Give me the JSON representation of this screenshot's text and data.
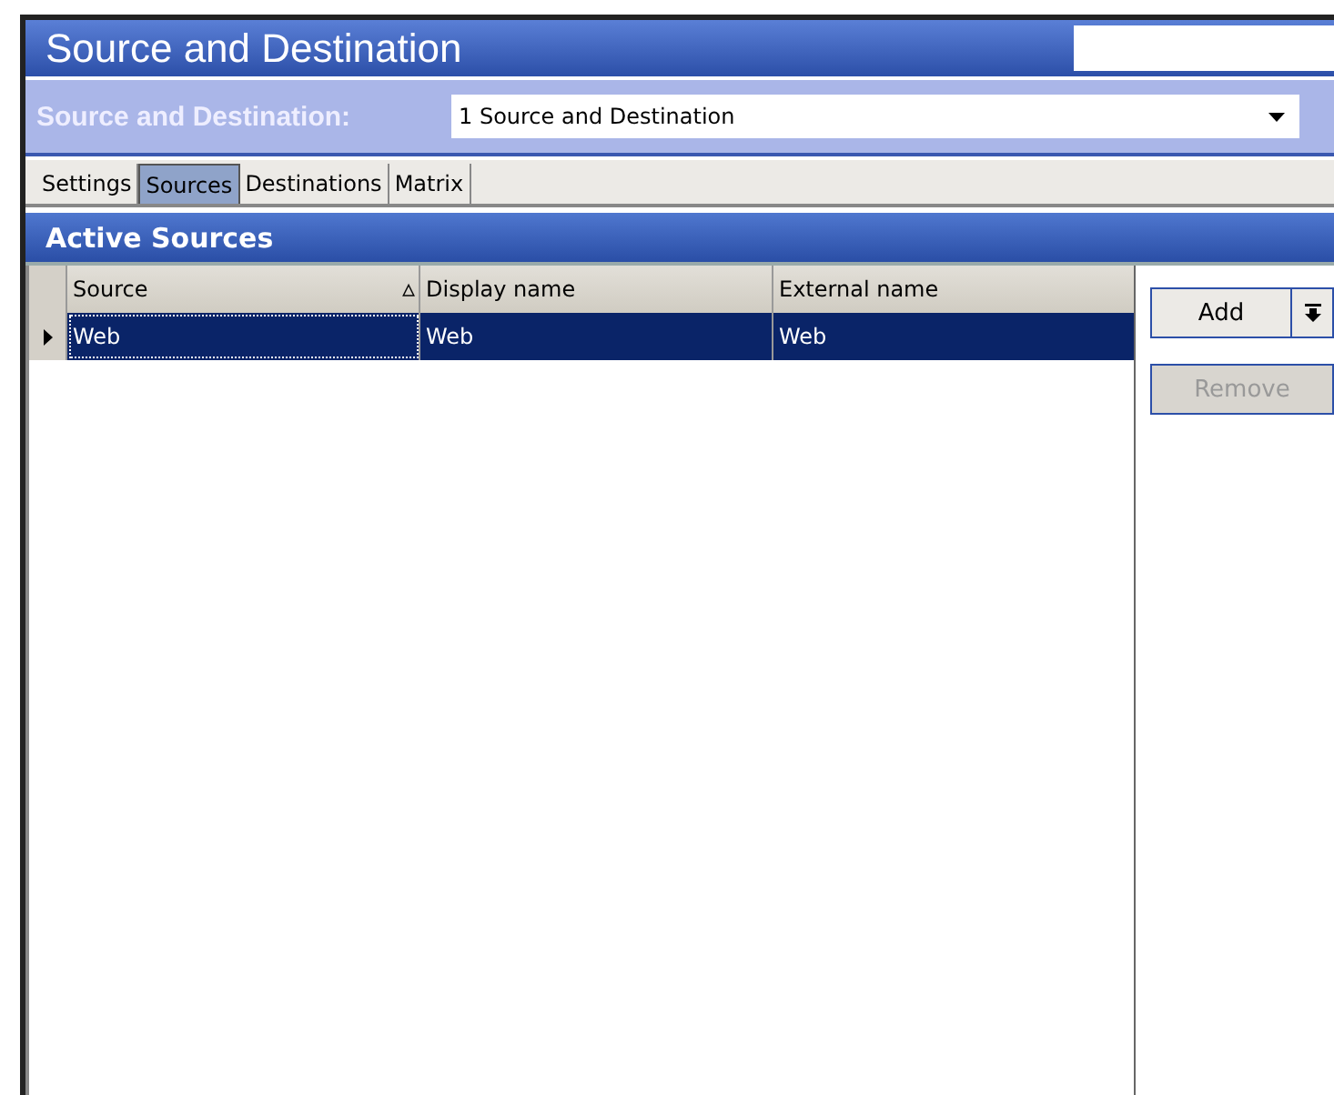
{
  "window": {
    "title": "Source and Destination"
  },
  "selector": {
    "label": "Source and Destination:",
    "value": "1 Source and Destination"
  },
  "tabs": [
    {
      "label": "Settings",
      "selected": false
    },
    {
      "label": "Sources",
      "selected": true
    },
    {
      "label": "Destinations",
      "selected": false
    },
    {
      "label": "Matrix",
      "selected": false
    }
  ],
  "section": {
    "title": "Active Sources"
  },
  "table": {
    "columns": [
      {
        "label": "Source",
        "sort": "▵"
      },
      {
        "label": "Display name"
      },
      {
        "label": "External name"
      }
    ],
    "rows": [
      {
        "selected": true,
        "cells": [
          "Web",
          "Web",
          "Web"
        ]
      }
    ]
  },
  "buttons": [
    {
      "label": "Add",
      "disabled": false,
      "dropdown": true
    },
    {
      "label": "Remove",
      "disabled": true,
      "dropdown": false
    }
  ]
}
